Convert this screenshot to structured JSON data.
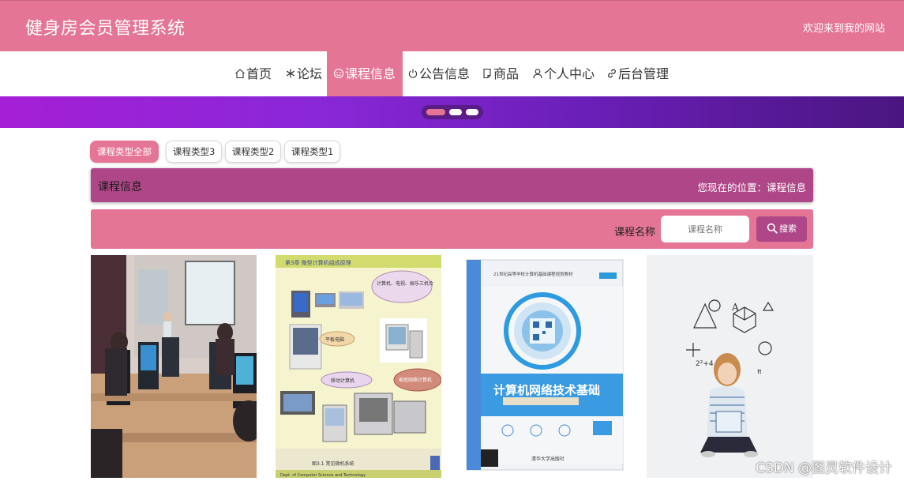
{
  "header": {
    "title": "健身房会员管理系统",
    "welcome": "欢迎来到我的网站"
  },
  "nav": {
    "items": [
      {
        "label": "首页",
        "icon": "home-icon"
      },
      {
        "label": "论坛",
        "icon": "snowflake-icon"
      },
      {
        "label": "课程信息",
        "icon": "smile-icon",
        "active": true
      },
      {
        "label": "公告信息",
        "icon": "power-icon"
      },
      {
        "label": "商品",
        "icon": "note-icon"
      },
      {
        "label": "个人中心",
        "icon": "user-icon"
      },
      {
        "label": "后台管理",
        "icon": "link-icon"
      }
    ]
  },
  "carousel": {
    "slides": 3,
    "active_index": 1
  },
  "filters": {
    "items": [
      "课程类型全部",
      "课程类型3",
      "课程类型2",
      "课程类型1"
    ],
    "active": "课程类型全部"
  },
  "breadcrumb": {
    "title": "课程信息",
    "location": "您现在的位置：课程信息"
  },
  "search": {
    "label": "课程名称",
    "placeholder": "课程名称",
    "value": "",
    "button": "搜索"
  },
  "cards": [
    {
      "image": "computer-lab-classroom-photo"
    },
    {
      "image": "computer-types-slide",
      "texts": [
        "第3章 微型计算机组成原理",
        "计算机、电视、娱乐三机合",
        "平板电脑",
        "移动计算机",
        "家庭网络计算机",
        "图3.1 常见微机系统",
        "Dept. of Computer Science and Technology"
      ]
    },
    {
      "image": "network-textbook-cover",
      "texts": [
        "21世纪高等学校计算机基础课程规划教材",
        "计算机网络技术基础",
        "清华大学出版社"
      ]
    },
    {
      "image": "girl-reading-formulas-photo"
    }
  ],
  "watermark": "CSDN @图灵软件设计",
  "colors": {
    "primary": "#e57595",
    "secondary": "#af4688",
    "banner_start": "#a51fd6",
    "banner_end": "#4a1580"
  }
}
